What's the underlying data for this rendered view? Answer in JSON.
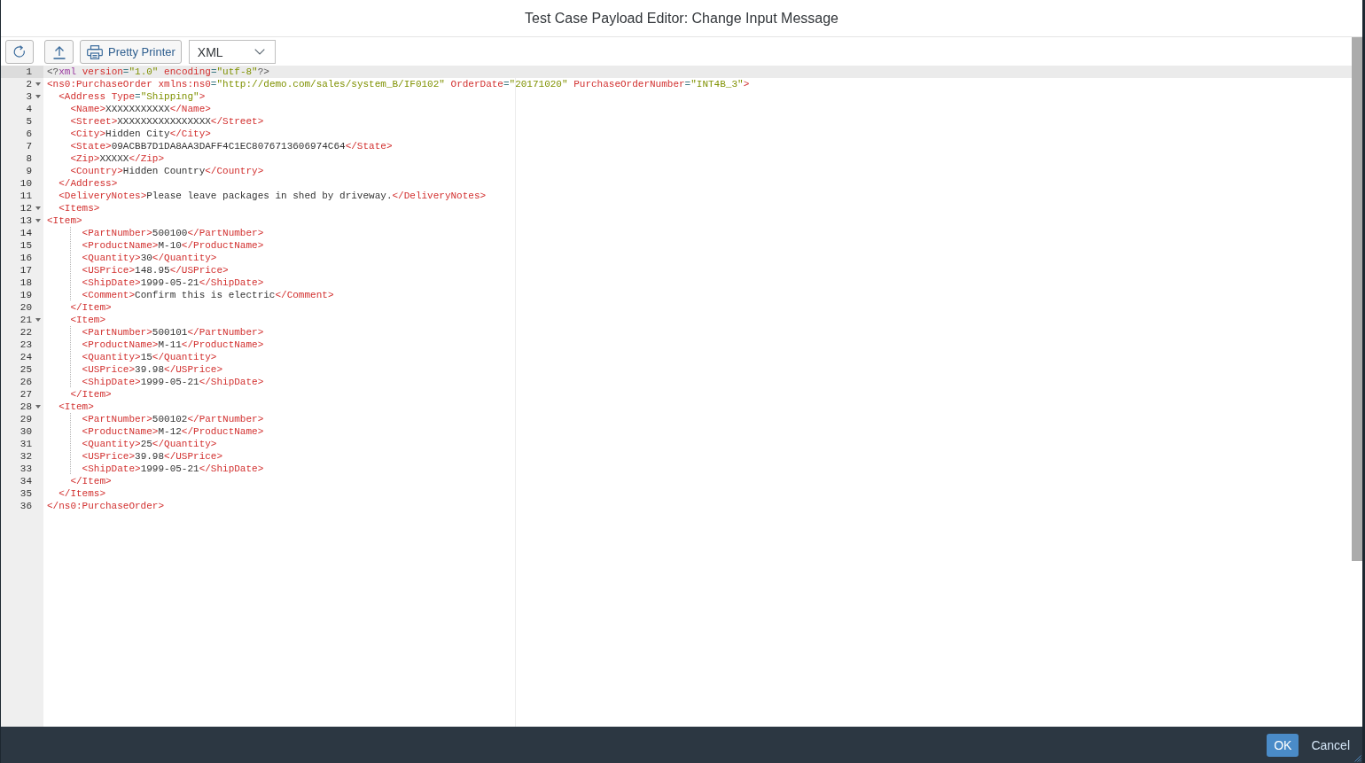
{
  "dialog": {
    "title": "Test Case Payload Editor: Change Input Message"
  },
  "toolbar": {
    "buttons": [
      {
        "kind": "refresh"
      },
      {
        "kind": "upload"
      },
      {
        "kind": "print",
        "label": "Pretty Printer"
      }
    ],
    "format_select": {
      "value": "XML"
    }
  },
  "editor": {
    "lines": [
      {
        "number": "1",
        "text": "<?xml version=\"1.0\" encoding=\"utf-8\"?>",
        "current": true
      },
      {
        "number": "2",
        "text": "<ns0:PurchaseOrder xmlns:ns0=\"http://demo.com/sales/system_B/IF0102\" OrderDate=\"20171020\" PurchaseOrderNumber=\"INT4B_3\">",
        "current": false,
        "expanded": true
      },
      {
        "number": "3",
        "text": "  <Address Type=\"Shipping\">",
        "current": false,
        "expanded": true
      },
      {
        "number": "4",
        "text": "    <Name>XXXXXXXXXXX</Name>",
        "current": false
      },
      {
        "number": "5",
        "text": "    <Street>XXXXXXXXXXXXXXXX</Street>",
        "current": false
      },
      {
        "number": "6",
        "text": "    <City>Hidden City</City>",
        "current": false
      },
      {
        "number": "7",
        "text": "    <State>09ACBB7D1DA8AA3DAFF4C1EC8076713606974C64</State>",
        "current": false
      },
      {
        "number": "8",
        "text": "    <Zip>XXXXX</Zip>",
        "current": false
      },
      {
        "number": "9",
        "text": "    <Country>Hidden Country</Country>",
        "current": false
      },
      {
        "number": "10",
        "text": "  </Address>",
        "current": false
      },
      {
        "number": "11",
        "text": "  <DeliveryNotes>Please leave packages in shed by driveway.</DeliveryNotes>",
        "current": false
      },
      {
        "number": "12",
        "text": "  <Items>",
        "current": false,
        "expanded": true
      },
      {
        "number": "13",
        "text": "<Item>",
        "current": false,
        "expanded": true
      },
      {
        "number": "14",
        "text": "      <PartNumber>500100</PartNumber>",
        "current": false
      },
      {
        "number": "15",
        "text": "      <ProductName>M-10</ProductName>",
        "current": false
      },
      {
        "number": "16",
        "text": "      <Quantity>30</Quantity>",
        "current": false
      },
      {
        "number": "17",
        "text": "      <USPrice>148.95</USPrice>",
        "current": false
      },
      {
        "number": "18",
        "text": "      <ShipDate>1999-05-21</ShipDate>",
        "current": false
      },
      {
        "number": "19",
        "text": "      <Comment>Confirm this is electric</Comment>",
        "current": false
      },
      {
        "number": "20",
        "text": "    </Item>",
        "current": false
      },
      {
        "number": "21",
        "text": "    <Item>",
        "current": false,
        "expanded": true
      },
      {
        "number": "22",
        "text": "      <PartNumber>500101</PartNumber>",
        "current": false
      },
      {
        "number": "23",
        "text": "      <ProductName>M-11</ProductName>",
        "current": false
      },
      {
        "number": "24",
        "text": "      <Quantity>15</Quantity>",
        "current": false
      },
      {
        "number": "25",
        "text": "      <USPrice>39.98</USPrice>",
        "current": false
      },
      {
        "number": "26",
        "text": "      <ShipDate>1999-05-21</ShipDate>",
        "current": false
      },
      {
        "number": "27",
        "text": "    </Item>",
        "current": false
      },
      {
        "number": "28",
        "text": "  <Item>",
        "current": false,
        "expanded": true
      },
      {
        "number": "29",
        "text": "      <PartNumber>500102</PartNumber>",
        "current": false
      },
      {
        "number": "30",
        "text": "      <ProductName>M-12</ProductName>",
        "current": false
      },
      {
        "number": "31",
        "text": "      <Quantity>25</Quantity>",
        "current": false
      },
      {
        "number": "32",
        "text": "      <USPrice>39.98</USPrice>",
        "current": false
      },
      {
        "number": "33",
        "text": "      <ShipDate>1999-05-21</ShipDate>",
        "current": false
      },
      {
        "number": "34",
        "text": "    </Item>",
        "current": false
      },
      {
        "number": "35",
        "text": "  </Items>",
        "current": false
      },
      {
        "number": "36",
        "text": "</ns0:PurchaseOrder>",
        "current": false
      }
    ]
  },
  "footer": {
    "buttons": [
      {
        "label": "OK",
        "kind": "primary"
      },
      {
        "label": "Cancel",
        "kind": "plain"
      }
    ]
  }
}
